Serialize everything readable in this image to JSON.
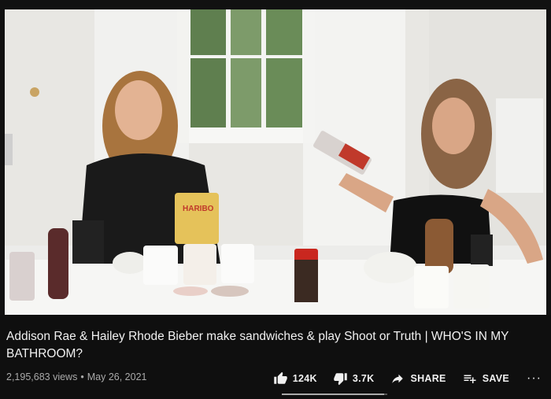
{
  "video": {
    "thumbnail_icon": "video-frame",
    "package_text": "HARIBO"
  },
  "title": "Addison Rae & Hailey Rhode Bieber make sandwiches & play Shoot or Truth | WHO'S IN MY BATHROOM?",
  "stats": {
    "views": "2,195,683 views",
    "separator": "•",
    "date": "May 26, 2021"
  },
  "actions": {
    "like_label": "124K",
    "dislike_label": "3.7K",
    "share_label": "SHARE",
    "save_label": "SAVE",
    "more_label": "···"
  },
  "sentiment": {
    "like_ratio": 0.97
  },
  "colors": {
    "background": "#0f0f0f",
    "primary_text": "#f1f1f1",
    "secondary_text": "#aaaaaa"
  }
}
